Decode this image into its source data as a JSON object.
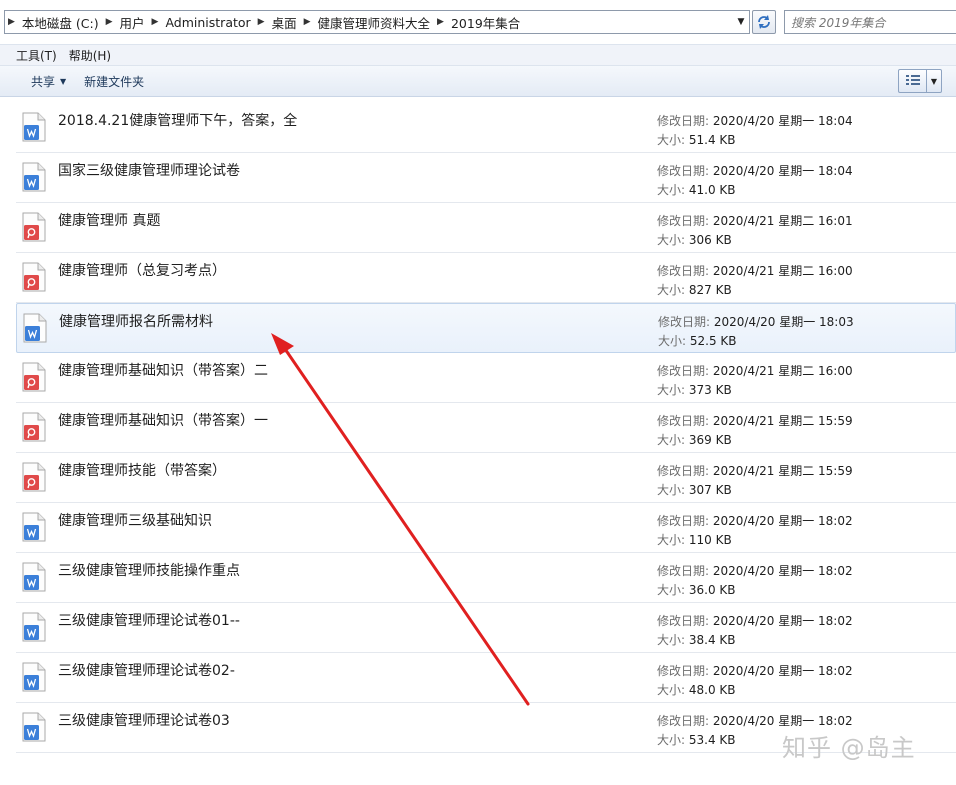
{
  "address": {
    "crumbs": [
      "本地磁盘 (C:)",
      "用户",
      "Administrator",
      "桌面",
      "健康管理师资料大全",
      "2019年集合"
    ],
    "search_placeholder": "搜索 2019年集合"
  },
  "menu": {
    "items": [
      "工具(T)",
      "帮助(H)"
    ]
  },
  "toolbar": {
    "share_label": "共享",
    "new_folder_label": "新建文件夹"
  },
  "labels": {
    "date": "修改日期:",
    "size": "大小:"
  },
  "files": [
    {
      "name": "2018.4.21健康管理师下午，答案，全",
      "type": "word",
      "date": "2020/4/20 星期一 18:04",
      "size": "51.4 KB"
    },
    {
      "name": "国家三级健康管理师理论试卷",
      "type": "word",
      "date": "2020/4/20 星期一 18:04",
      "size": "41.0 KB"
    },
    {
      "name": "健康管理师 真题",
      "type": "pdf",
      "date": "2020/4/21 星期二 16:01",
      "size": "306 KB"
    },
    {
      "name": "健康管理师（总复习考点）",
      "type": "pdf",
      "date": "2020/4/21 星期二 16:00",
      "size": "827 KB"
    },
    {
      "name": "健康管理师报名所需材料",
      "type": "word",
      "date": "2020/4/20 星期一 18:03",
      "size": "52.5 KB",
      "selected": true
    },
    {
      "name": "健康管理师基础知识（带答案）二",
      "type": "pdf",
      "date": "2020/4/21 星期二 16:00",
      "size": "373 KB"
    },
    {
      "name": "健康管理师基础知识（带答案）一",
      "type": "pdf",
      "date": "2020/4/21 星期二 15:59",
      "size": "369 KB"
    },
    {
      "name": "健康管理师技能（带答案）",
      "type": "pdf",
      "date": "2020/4/21 星期二 15:59",
      "size": "307 KB"
    },
    {
      "name": "健康管理师三级基础知识",
      "type": "word",
      "date": "2020/4/20 星期一 18:02",
      "size": "110 KB"
    },
    {
      "name": "三级健康管理师技能操作重点",
      "type": "word",
      "date": "2020/4/20 星期一 18:02",
      "size": "36.0 KB"
    },
    {
      "name": "三级健康管理师理论试卷01--",
      "type": "word",
      "date": "2020/4/20 星期一 18:02",
      "size": "38.4 KB"
    },
    {
      "name": "三级健康管理师理论试卷02-",
      "type": "word",
      "date": "2020/4/20 星期一 18:02",
      "size": "48.0 KB"
    },
    {
      "name": "三级健康管理师理论试卷03",
      "type": "word",
      "date": "2020/4/20 星期一 18:02",
      "size": "53.4 KB"
    }
  ],
  "colors": {
    "arrow": "#e02020",
    "word_icon": "#3b7fd9",
    "pdf_icon": "#e04a4a"
  },
  "watermark": "知乎 @岛主"
}
